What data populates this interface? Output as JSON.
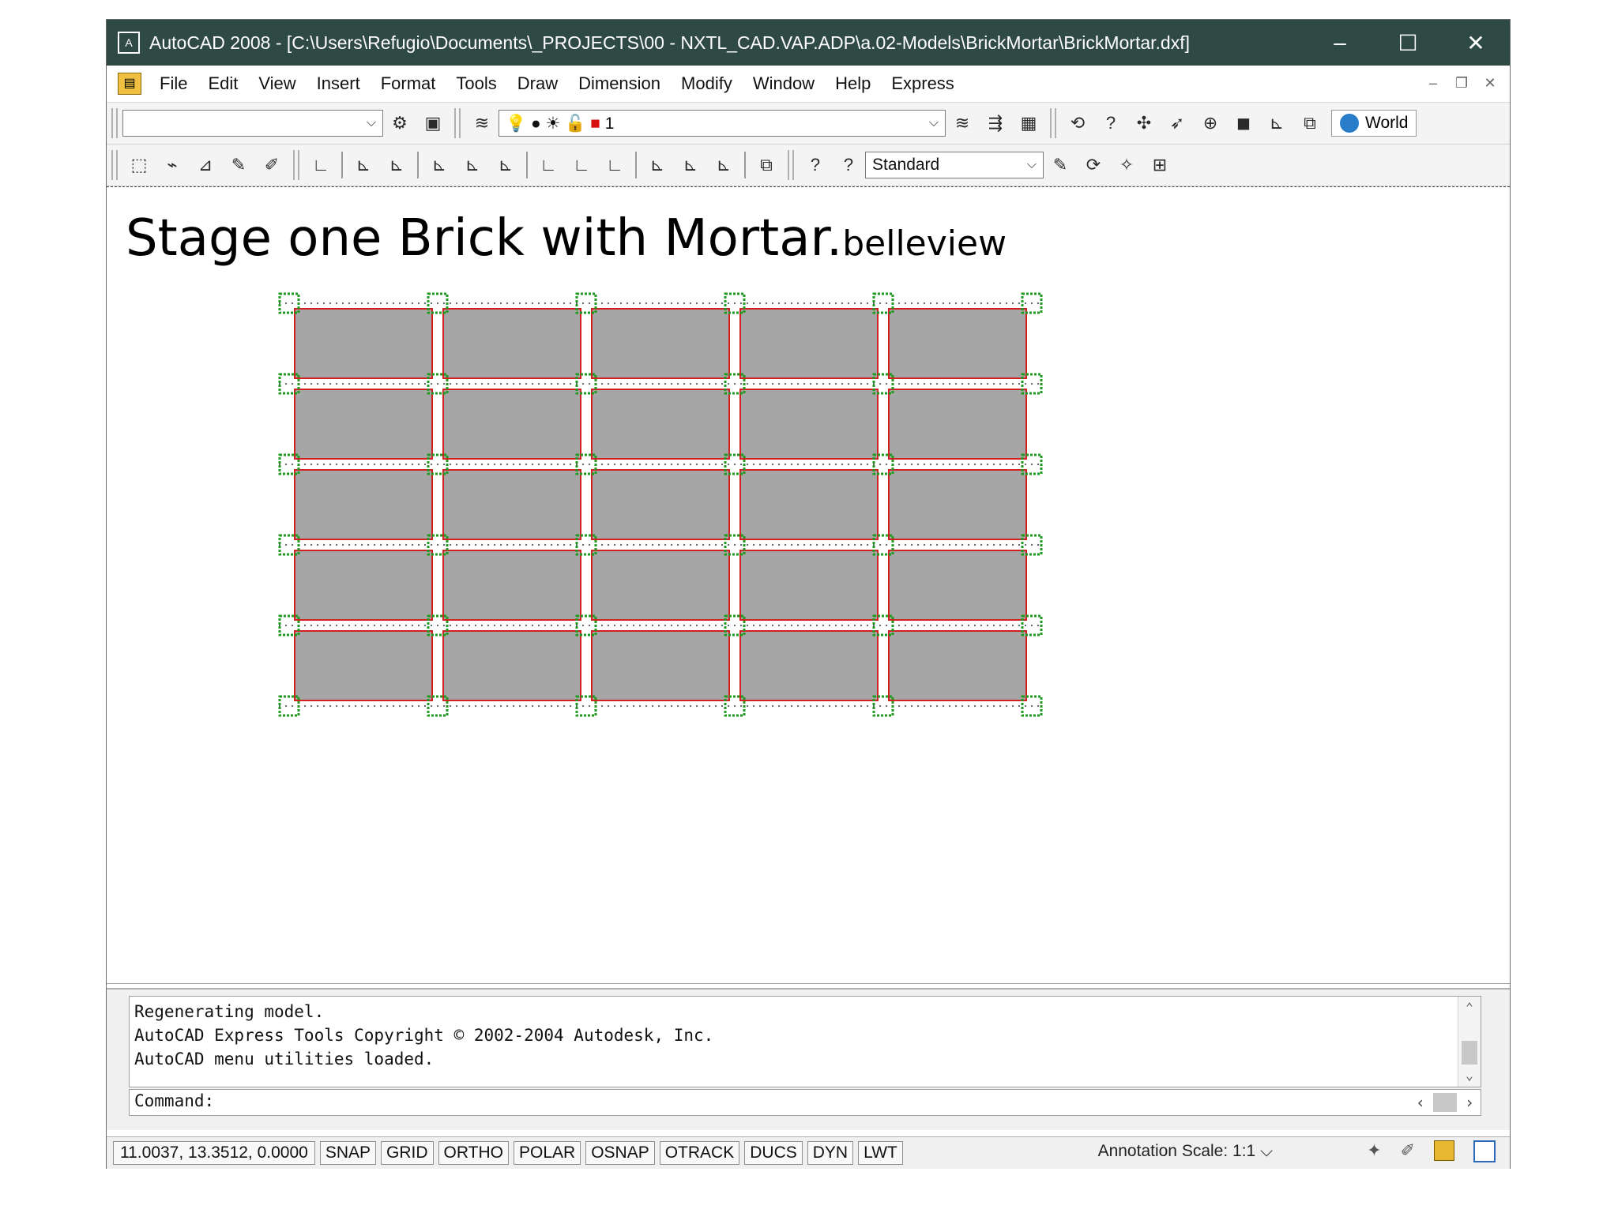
{
  "window": {
    "title": "AutoCAD 2008 - [C:\\Users\\Refugio\\Documents\\_PROJECTS\\00 - NXTL_CAD.VAP.ADP\\a.02-Models\\BrickMortar\\BrickMortar.dxf]",
    "minimize": "–",
    "maximize": "☐",
    "close": "✕"
  },
  "menu": {
    "items": [
      "File",
      "Edit",
      "View",
      "Insert",
      "Format",
      "Tools",
      "Draw",
      "Dimension",
      "Modify",
      "Window",
      "Help",
      "Express"
    ]
  },
  "layers_toolbar": {
    "workspace_value": "",
    "layer_value": "1",
    "ucs_value": "World"
  },
  "dim_toolbar": {
    "dimstyle_value": "Standard"
  },
  "slide": {
    "title": "Stage one Brick with Mortar.",
    "subtitle": "belleview"
  },
  "drawing_colors": {
    "brick_fill": "#a6a6a6",
    "brick_outline": "#d02020",
    "mortar_marks": "#1f9a1f"
  },
  "command": {
    "history": [
      "Regenerating model.",
      "AutoCAD Express Tools Copyright © 2002-2004 Autodesk, Inc.",
      "AutoCAD menu utilities loaded."
    ],
    "prompt": "Command:"
  },
  "status": {
    "coordinates": "11.0037, 13.3512, 0.0000",
    "toggles": [
      "SNAP",
      "GRID",
      "ORTHO",
      "POLAR",
      "OSNAP",
      "OTRACK",
      "DUCS",
      "DYN",
      "LWT"
    ],
    "annotation_scale_label": "Annotation Scale:",
    "annotation_scale_value": "1:1"
  }
}
